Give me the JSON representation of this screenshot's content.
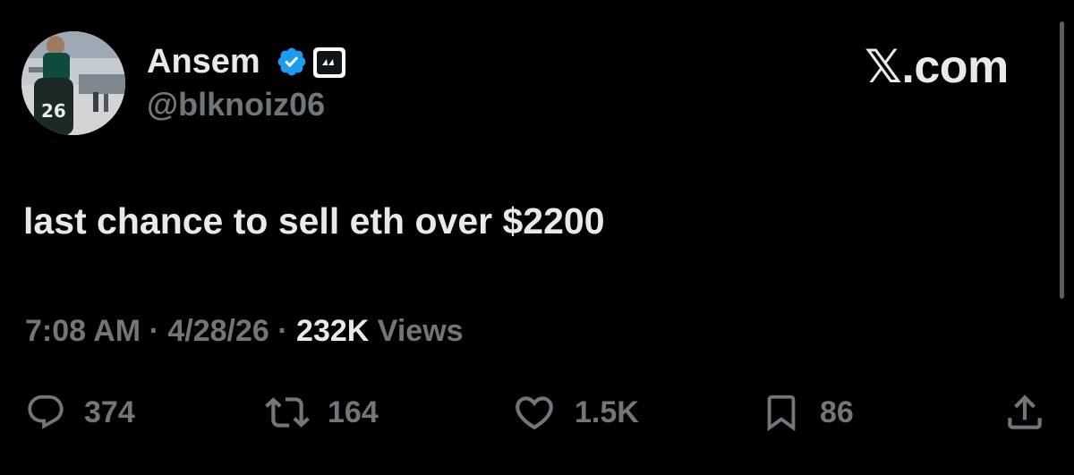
{
  "author": {
    "display_name": "Ansem",
    "handle": "@blknoiz06",
    "verified": true,
    "avatar_jersey_number": "26"
  },
  "brand": "𝕏.com",
  "tweet": {
    "text": "last chance to sell eth over $2200"
  },
  "meta": {
    "time": "7:08 AM",
    "separator": "·",
    "date": "4/28/26",
    "views_count": "232K",
    "views_label": "Views"
  },
  "actions": {
    "replies": "374",
    "reposts": "164",
    "likes": "1.5K",
    "bookmarks": "86"
  },
  "colors": {
    "background": "#000000",
    "primary_text": "#e7e9ea",
    "secondary_text": "#71767b",
    "verified_badge": "#1d9bf0"
  }
}
